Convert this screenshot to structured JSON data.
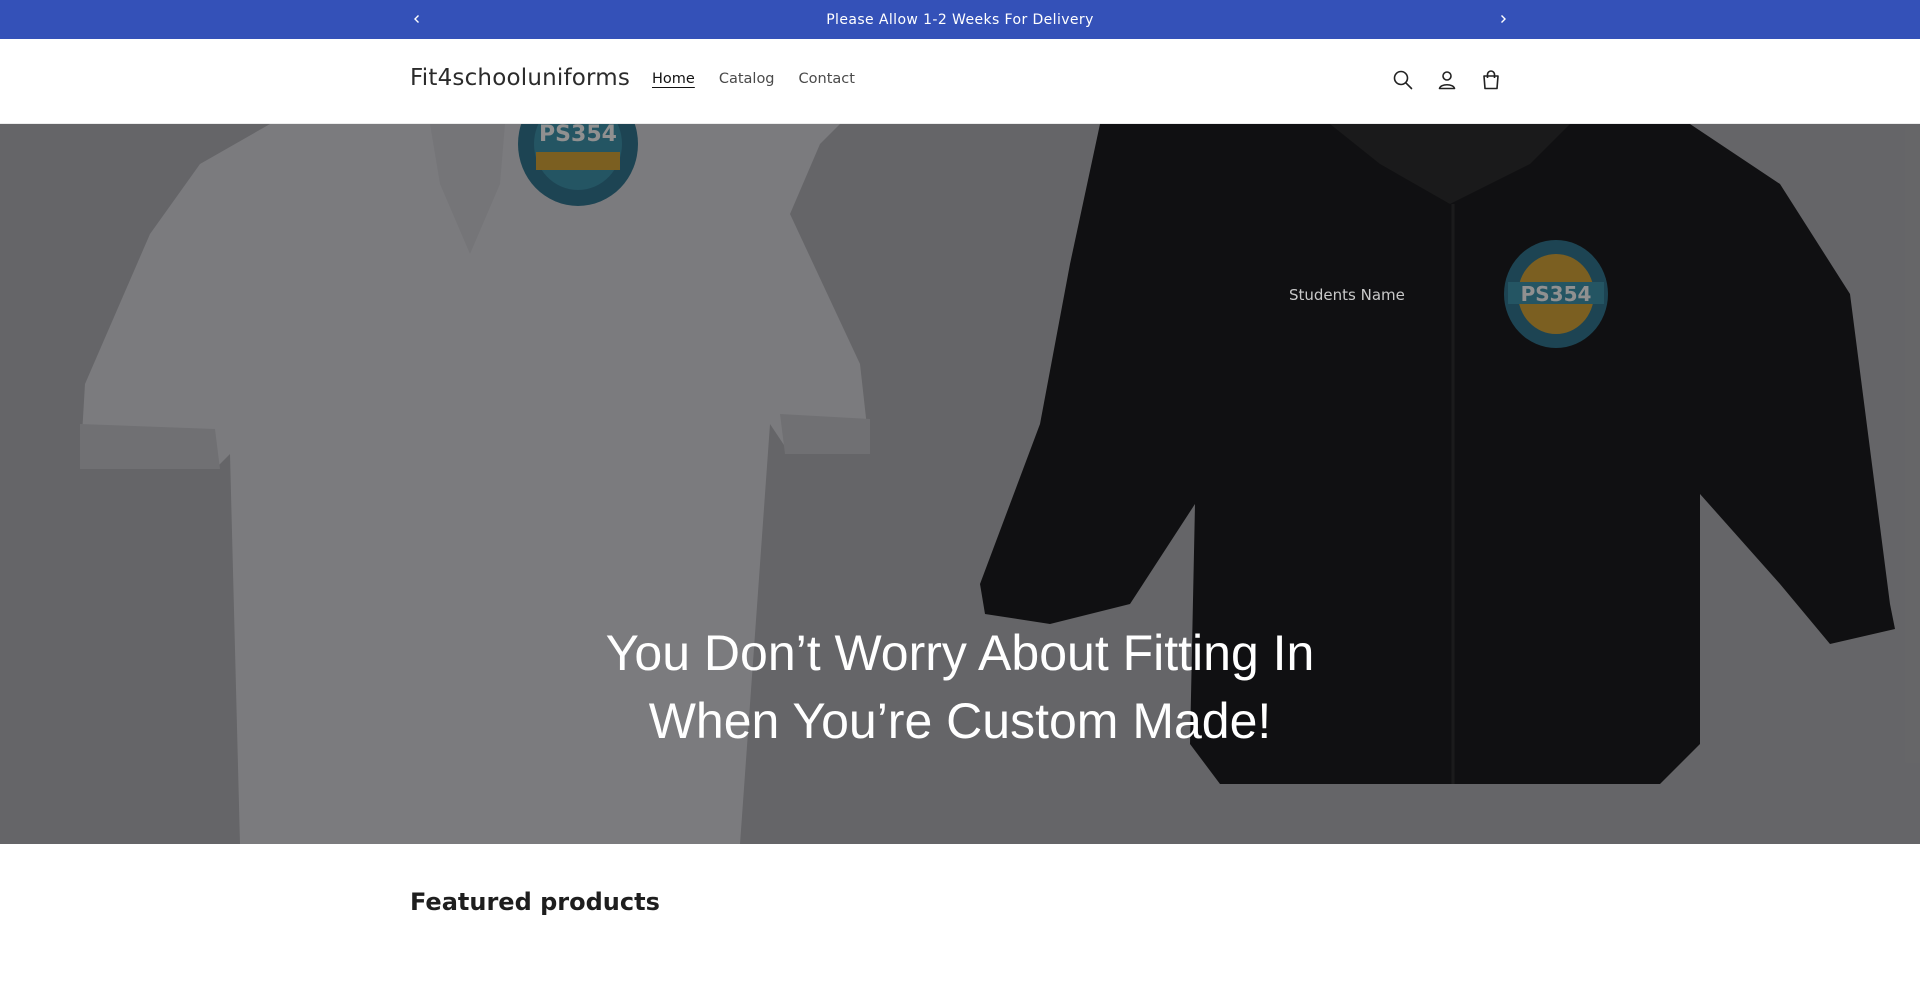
{
  "announcement": {
    "text": "Please Allow 1-2 Weeks For Delivery",
    "prev_icon": "chevron-left-icon",
    "next_icon": "chevron-right-icon"
  },
  "header": {
    "logo": "Fit4schooluniforms",
    "nav": [
      {
        "label": "Home",
        "active": true
      },
      {
        "label": "Catalog",
        "active": false
      },
      {
        "label": "Contact",
        "active": false
      }
    ],
    "icons": [
      "search-icon",
      "account-icon",
      "cart-icon"
    ]
  },
  "hero": {
    "heading_line1": "You Don’t Worry About Fitting In",
    "heading_line2": "When You’re Custom Made!",
    "jacket_label": "Students Name",
    "badge_text": "PS354"
  },
  "featured": {
    "title": "Featured products"
  },
  "colors": {
    "announcement_bg": "#3451b8",
    "header_bg": "#ffffff",
    "hero_text": "#ffffff"
  }
}
